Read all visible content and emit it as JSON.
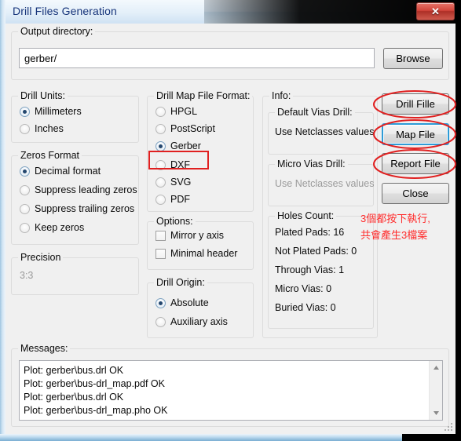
{
  "window": {
    "title": "Drill Files Generation",
    "close_label": "✕"
  },
  "output_directory": {
    "legend": "Output directory:",
    "value": "gerber/",
    "browse_label": "Browse"
  },
  "drill_units": {
    "legend": "Drill Units:",
    "options": [
      {
        "label": "Millimeters",
        "checked": true
      },
      {
        "label": "Inches",
        "checked": false
      }
    ]
  },
  "zeros_format": {
    "legend": "Zeros Format",
    "options": [
      {
        "label": "Decimal format",
        "checked": true
      },
      {
        "label": "Suppress leading zeros",
        "checked": false
      },
      {
        "label": "Suppress trailing zeros",
        "checked": false
      },
      {
        "label": "Keep zeros",
        "checked": false
      }
    ]
  },
  "precision": {
    "legend": "Precision",
    "value": "3:3"
  },
  "drill_map_file_format": {
    "legend": "Drill Map File Format:",
    "options": [
      {
        "label": "HPGL",
        "checked": false
      },
      {
        "label": "PostScript",
        "checked": false
      },
      {
        "label": "Gerber",
        "checked": true
      },
      {
        "label": "DXF",
        "checked": false
      },
      {
        "label": "SVG",
        "checked": false
      },
      {
        "label": "PDF",
        "checked": false
      }
    ]
  },
  "options": {
    "legend": "Options:",
    "items": [
      {
        "label": "Mirror y axis",
        "checked": false
      },
      {
        "label": "Minimal header",
        "checked": false
      }
    ]
  },
  "drill_origin": {
    "legend": "Drill Origin:",
    "options": [
      {
        "label": "Absolute",
        "checked": true
      },
      {
        "label": "Auxiliary axis",
        "checked": false
      }
    ]
  },
  "info": {
    "legend": "Info:",
    "default_vias_drill": {
      "legend": "Default Vias Drill:",
      "value": "Use Netclasses values"
    },
    "micro_vias_drill": {
      "legend": "Micro Vias Drill:",
      "value": "Use Netclasses values"
    },
    "holes_count": {
      "legend": "Holes Count:",
      "rows": [
        "Plated Pads: 16",
        "Not Plated Pads: 0",
        "Through Vias: 1",
        "Micro Vias: 0",
        "Buried Vias: 0"
      ]
    }
  },
  "action_buttons": {
    "drill_file": "Drill Fille",
    "map_file": "Map File",
    "report_file": "Report File",
    "close": "Close"
  },
  "messages": {
    "legend": "Messages:",
    "lines": [
      "Plot: gerber\\bus.drl OK",
      "Plot: gerber\\bus-drl_map.pdf OK",
      "Plot: gerber\\bus.drl OK",
      "Plot: gerber\\bus-drl_map.pho OK"
    ]
  },
  "annotation": {
    "line1": "3個都按下執行,",
    "line2": "共會產生3檔案",
    "color": "#ff2b2b"
  }
}
